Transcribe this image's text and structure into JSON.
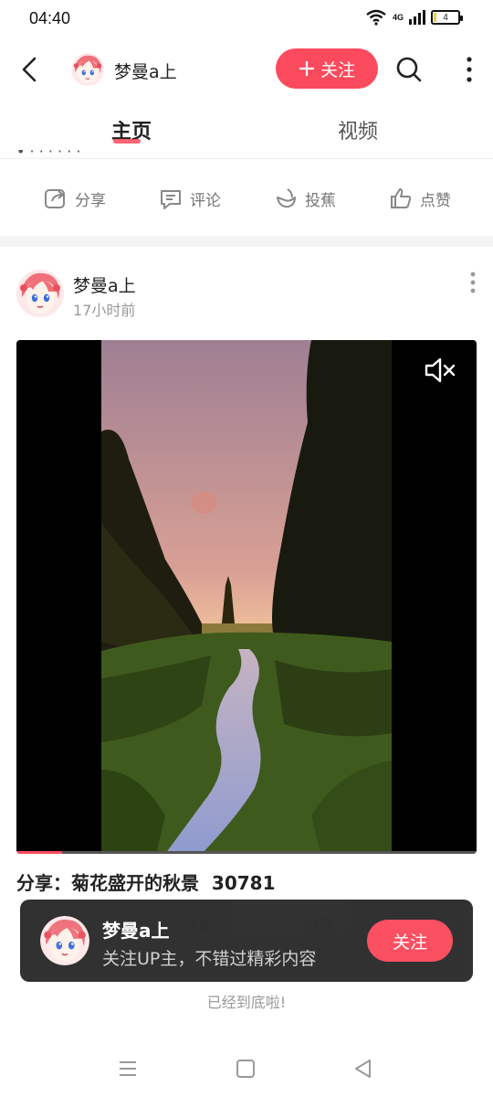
{
  "status_bar": {
    "time": "04:40",
    "network": "4G",
    "battery": "4",
    "battery_level": 0.1
  },
  "header": {
    "username": "梦曼a上",
    "follow_label": "关注"
  },
  "tabs": [
    {
      "label": "主页"
    },
    {
      "label": "视频"
    }
  ],
  "previous_post": {
    "actions": [
      {
        "label": "分享"
      },
      {
        "label": "评论"
      },
      {
        "label": "投蕉"
      },
      {
        "label": "点赞"
      }
    ]
  },
  "post": {
    "author": "梦曼a上",
    "time": "17小时前",
    "caption": "分享：菊花盛开的秋景  30781",
    "video_progress": 0.1
  },
  "follow_toast": {
    "name": "梦曼a上",
    "description": "关注UP主，不错过精彩内容",
    "button_label": "关注"
  },
  "feed_end_text": "已经到底啦!",
  "icons": {
    "back": "back-arrow-icon",
    "search": "search-icon",
    "more": "more-vertical-icon",
    "share": "share-icon",
    "comment": "comment-icon",
    "banana": "banana-icon",
    "like": "thumbs-up-icon",
    "mute": "speaker-muted-icon",
    "nav_menu": "menu-icon",
    "nav_home": "square-home-icon",
    "nav_back": "triangle-back-icon"
  },
  "colors": {
    "accent": "#fb4a5d",
    "toast_bg": "#2b2b2b"
  }
}
